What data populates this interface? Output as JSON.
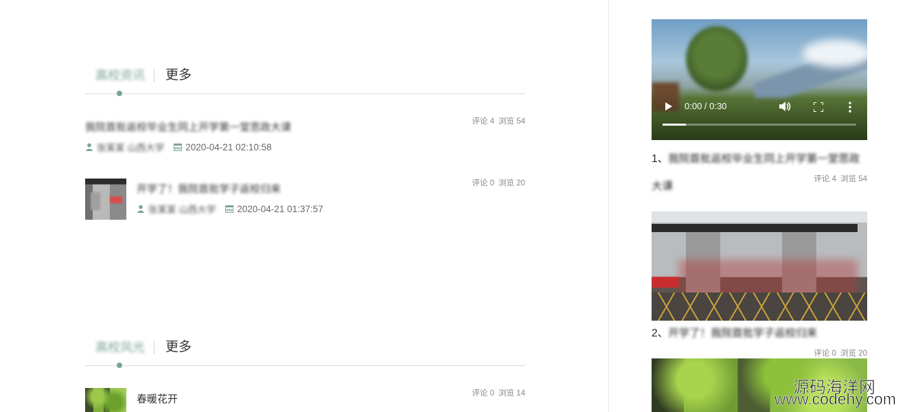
{
  "sections": [
    {
      "title": "高校资讯",
      "more": "更多",
      "items": [
        {
          "title": "我院首批返校毕业生同上开学第一堂思政大课",
          "author": "张某某 山西大学",
          "date": "2020-04-21 02:10:58",
          "comments": "评论 4",
          "views": "浏览 54"
        },
        {
          "title": "开学了！我院首批学子返校归来",
          "author": "张某某 山西大学",
          "date": "2020-04-21 01:37:57",
          "comments": "评论 0",
          "views": "浏览 20"
        }
      ]
    },
    {
      "title": "高校风光",
      "more": "更多",
      "items": [
        {
          "title": "春暖花开",
          "comments": "评论 0",
          "views": "浏览 14"
        }
      ]
    }
  ],
  "side": {
    "video": {
      "time": "0:00 / 0:30",
      "progress": 0.12
    },
    "items": [
      {
        "num": "1、",
        "title": "我院首批返校毕业生同上开学第一堂思政大课",
        "comments": "评论 4",
        "views": "浏览 54"
      },
      {
        "num": "2、",
        "title": "开学了！我院首批学子返校归来",
        "comments": "评论 0",
        "views": "浏览 20"
      }
    ]
  },
  "watermark": {
    "line1": "源码海洋网",
    "line2": "www.codehy.com"
  },
  "colors": {
    "accent": "#7aa493",
    "divider": "#dcdcdc"
  }
}
